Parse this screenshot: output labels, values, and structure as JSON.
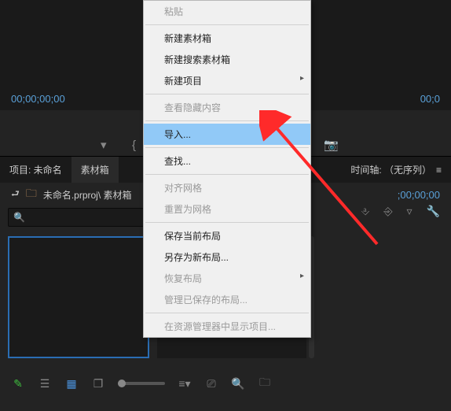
{
  "timecodes": {
    "left": "00;00;00;00",
    "right": "00;0",
    "timeline": ";00;00;00"
  },
  "panels": {
    "project_tab": "项目: 未命名",
    "bin_tab": "素材箱",
    "timeline_label": "时间轴: （无序列）"
  },
  "project": {
    "path": "未命名.prproj\\ 素材箱"
  },
  "search": {
    "placeholder": ""
  },
  "context_menu": {
    "paste": "粘贴",
    "new_bin": "新建素材箱",
    "new_search_bin": "新建搜索素材箱",
    "new_item": "新建项目",
    "show_hidden": "查看隐藏内容",
    "import": "导入...",
    "find": "查找...",
    "align_grid": "对齐网格",
    "reset_grid": "重置为网格",
    "save_layout": "保存当前布局",
    "save_layout_as": "另存为新布局...",
    "restore_layout": "恢复布局",
    "manage_layouts": "管理已保存的布局...",
    "reveal": "在资源管理器中显示项目..."
  },
  "colors": {
    "highlight": "#91c9f7",
    "accent_blue": "#5aa0d8",
    "arrow": "#ff2a2a"
  }
}
